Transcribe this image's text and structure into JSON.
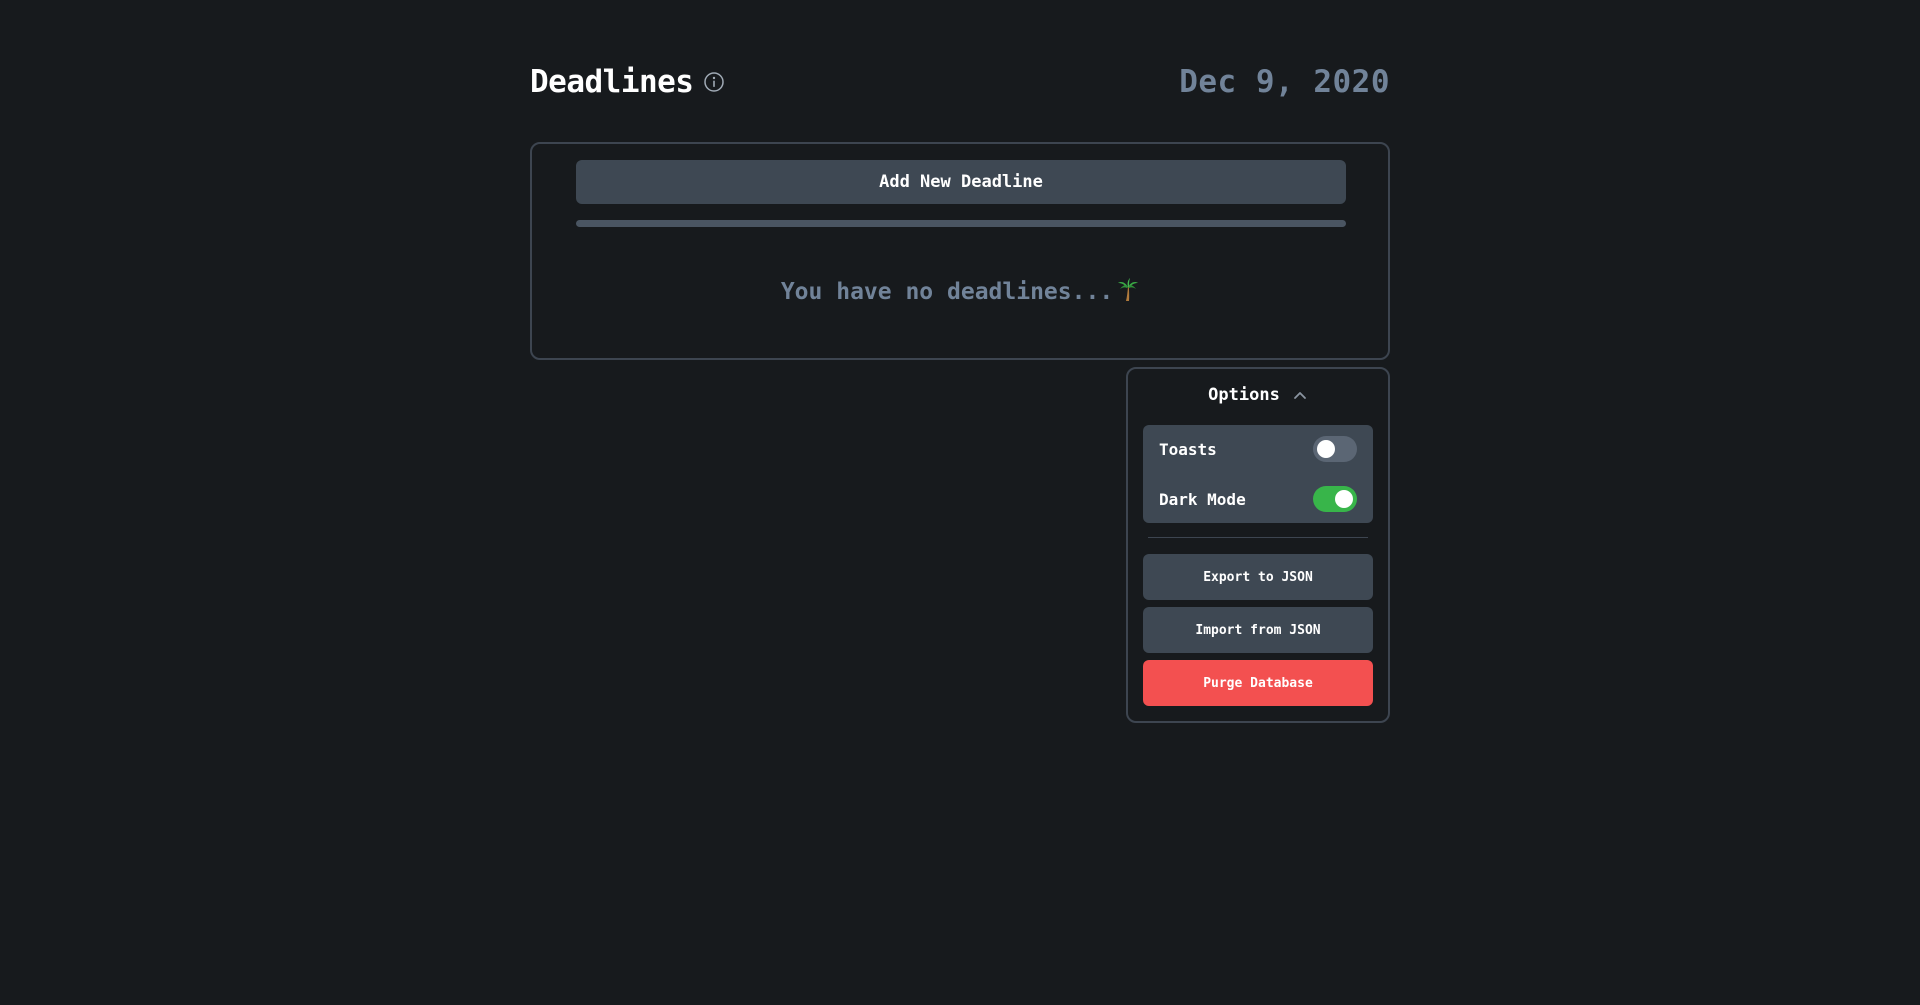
{
  "header": {
    "title": "Deadlines",
    "date": "Dec 9, 2020",
    "info_icon": "info-circle-icon"
  },
  "main": {
    "add_button_label": "Add New Deadline",
    "progress_percent": 100,
    "empty_message": "You have no deadlines..."
  },
  "options": {
    "title": "Options",
    "expanded": true,
    "toggles": [
      {
        "label": "Toasts",
        "on": false
      },
      {
        "label": "Dark Mode",
        "on": true
      }
    ],
    "export_label": "Export to JSON",
    "import_label": "Import from JSON",
    "purge_label": "Purge Database"
  },
  "colors": {
    "background": "#171a1d",
    "card_border": "#3d4550",
    "button_bg": "#3e4853",
    "muted_text": "#718399",
    "toggle_on": "#38b54a",
    "toggle_off": "#5b6674",
    "danger": "#f35050"
  }
}
